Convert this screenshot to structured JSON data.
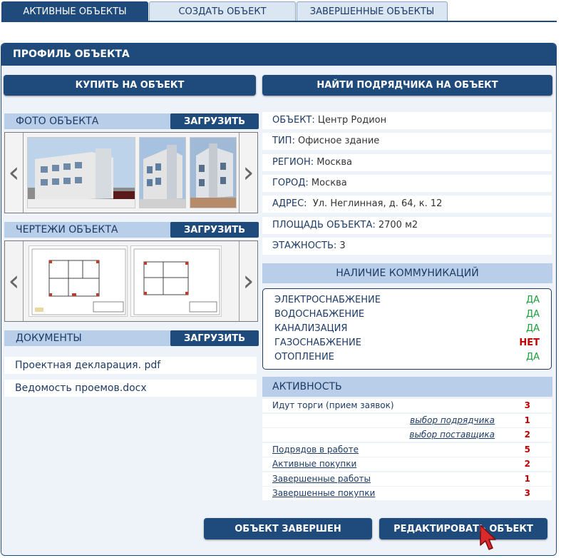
{
  "tabs": [
    {
      "label": "АКТИВНЫЕ ОБЪЕКТЫ"
    },
    {
      "label": "СОЗДАТЬ ОБЪЕКТ"
    },
    {
      "label": "ЗАВЕРШЕННЫЕ ОБЪЕКТЫ"
    }
  ],
  "panel_title": "ПРОФИЛЬ ОБЪЕКТА",
  "buy_button": "КУПИТЬ НА ОБЪЕКТ",
  "find_contractor_button": "НАЙТИ ПОДРЯДЧИКА НА ОБЪЕКТ",
  "photos": {
    "title": "ФОТО ОБЪЕКТА",
    "upload": "ЗАГРУЗИТЬ"
  },
  "drawings": {
    "title": "ЧЕРТЕЖИ ОБЪЕКТА",
    "upload": "ЗАГРУЗИТЬ"
  },
  "documents": {
    "title": "ДОКУМЕНТЫ",
    "upload": "ЗАГРУЗИТЬ",
    "items": [
      "Проектная декларация. pdf",
      "Ведомость проемов.docx"
    ]
  },
  "info": [
    {
      "key": "ОБЪЕКТ:",
      "value": " Центр Родион"
    },
    {
      "key": "ТИП:",
      "value": " Офисное здание"
    },
    {
      "key": "РЕГИОН:",
      "value": " Москва"
    },
    {
      "key": "ГОРОД:",
      "value": " Москва"
    },
    {
      "key": "АДРЕС:",
      "value": "  Ул. Неглинная, д. 64, к. 12"
    },
    {
      "key": "ПЛОЩАДЬ ОБЪЕКТА:",
      "value": " 2700 м2"
    },
    {
      "key": "ЭТАЖНОСТЬ:",
      "value": " 3"
    }
  ],
  "communications": {
    "title": "НАЛИЧИЕ КОММУНИКАЦИЙ",
    "items": [
      {
        "name": "ЭЛЕКТРОСНАБЖЕНИЕ",
        "status": "ДА"
      },
      {
        "name": "ВОДОСНАБЖЕНИЕ",
        "status": "ДА"
      },
      {
        "name": "КАНАЛИЗАЦИЯ",
        "status": "ДА"
      },
      {
        "name": "ГАЗОСНАБЖЕНИЕ",
        "status": "НЕТ"
      },
      {
        "name": "ОТОПЛЕНИЕ",
        "status": "ДА"
      }
    ]
  },
  "activity": {
    "title": "АКТИВНОСТЬ",
    "items": [
      {
        "label": "Идут торги (прием заявок)",
        "count": "3"
      },
      {
        "label": "выбор подрядчика",
        "count": "1"
      },
      {
        "label": "выбор поставщика",
        "count": "2"
      },
      {
        "label": "Подрядов в работе",
        "count": "5"
      },
      {
        "label": "Активные покупки",
        "count": "2"
      },
      {
        "label": "Завершенные работы",
        "count": "1"
      },
      {
        "label": "Завершенные покупки",
        "count": "3"
      }
    ]
  },
  "complete_button": "ОБЪЕКТ ЗАВЕРШЕН",
  "edit_button": "РЕДАКТИРОВАТЬ ОБЪЕКТ",
  "colors": {
    "primary": "#1f4a7c",
    "section": "#b9cfe9",
    "yes": "#1a9e3a",
    "no": "#c00000"
  }
}
